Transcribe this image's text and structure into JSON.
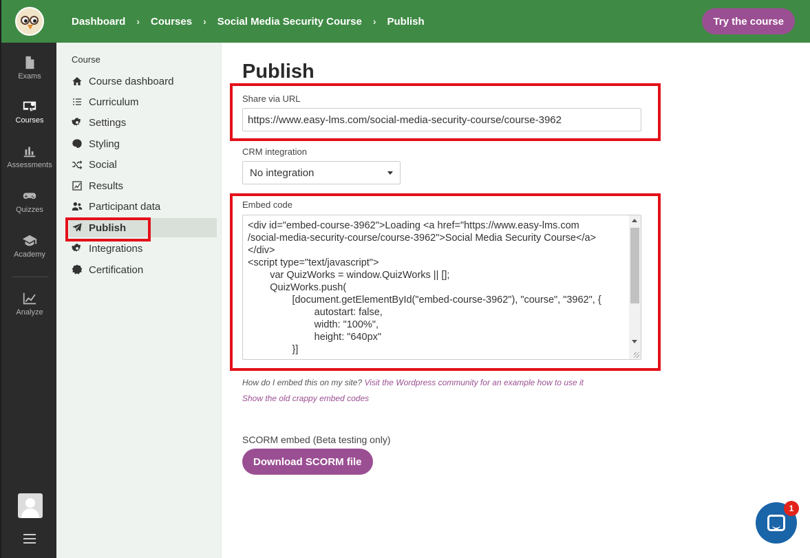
{
  "rail": {
    "items": [
      {
        "label": "Exams",
        "icon": "document-icon"
      },
      {
        "label": "Courses",
        "icon": "certificate-icon"
      },
      {
        "label": "Assessments",
        "icon": "bar-chart-icon"
      },
      {
        "label": "Quizzes",
        "icon": "gamepad-icon"
      },
      {
        "label": "Academy",
        "icon": "graduation-cap-icon"
      },
      {
        "label": "Analyze",
        "icon": "line-chart-icon"
      }
    ]
  },
  "header": {
    "breadcrumbs": [
      "Dashboard",
      "Courses",
      "Social Media Security Course",
      "Publish"
    ],
    "separator": "›",
    "try_label": "Try the course"
  },
  "subnav": {
    "title": "Course",
    "items": [
      {
        "label": "Course dashboard",
        "icon": "home-icon"
      },
      {
        "label": "Curriculum",
        "icon": "list-icon"
      },
      {
        "label": "Settings",
        "icon": "gear-icon"
      },
      {
        "label": "Styling",
        "icon": "palette-icon"
      },
      {
        "label": "Social",
        "icon": "shuffle-icon"
      },
      {
        "label": "Results",
        "icon": "chart-icon"
      },
      {
        "label": "Participant data",
        "icon": "users-icon"
      },
      {
        "label": "Publish",
        "icon": "paper-plane-icon"
      },
      {
        "label": "Integrations",
        "icon": "gear-icon"
      },
      {
        "label": "Certification",
        "icon": "badge-icon"
      }
    ],
    "active": "Publish"
  },
  "main": {
    "title": "Publish",
    "share_label": "Share via URL",
    "share_url": "https://www.easy-lms.com/social-media-security-course/course-3962",
    "crm_label": "CRM integration",
    "crm_value": "No integration",
    "embed_label": "Embed code",
    "embed_code": "<div id=\"embed-course-3962\">Loading <a href=\"https://www.easy-lms.com\n/social-media-security-course/course-3962\">Social Media Security Course</a>\n</div>\n<script type=\"text/javascript\">\n        var QuizWorks = window.QuizWorks || [];\n        QuizWorks.push(\n                [document.getElementById(\"embed-course-3962\"), \"course\", \"3962\", {\n                        autostart: false,\n                        width: \"100%\",\n                        height: \"640px\"\n                }]",
    "help_prefix": "How do I embed this on my site?",
    "help_link": "Visit the Wordpress community for an example how to use it",
    "old_codes_link": "Show the old crappy embed codes",
    "scorm_label": "SCORM embed (Beta testing only)",
    "scorm_button": "Download SCORM file"
  },
  "chat": {
    "badge": "1"
  },
  "colors": {
    "brand_green": "#3f8a45",
    "accent_purple": "#9b4f93",
    "highlight_red": "#e3101a",
    "chat_blue": "#1a64a8"
  }
}
